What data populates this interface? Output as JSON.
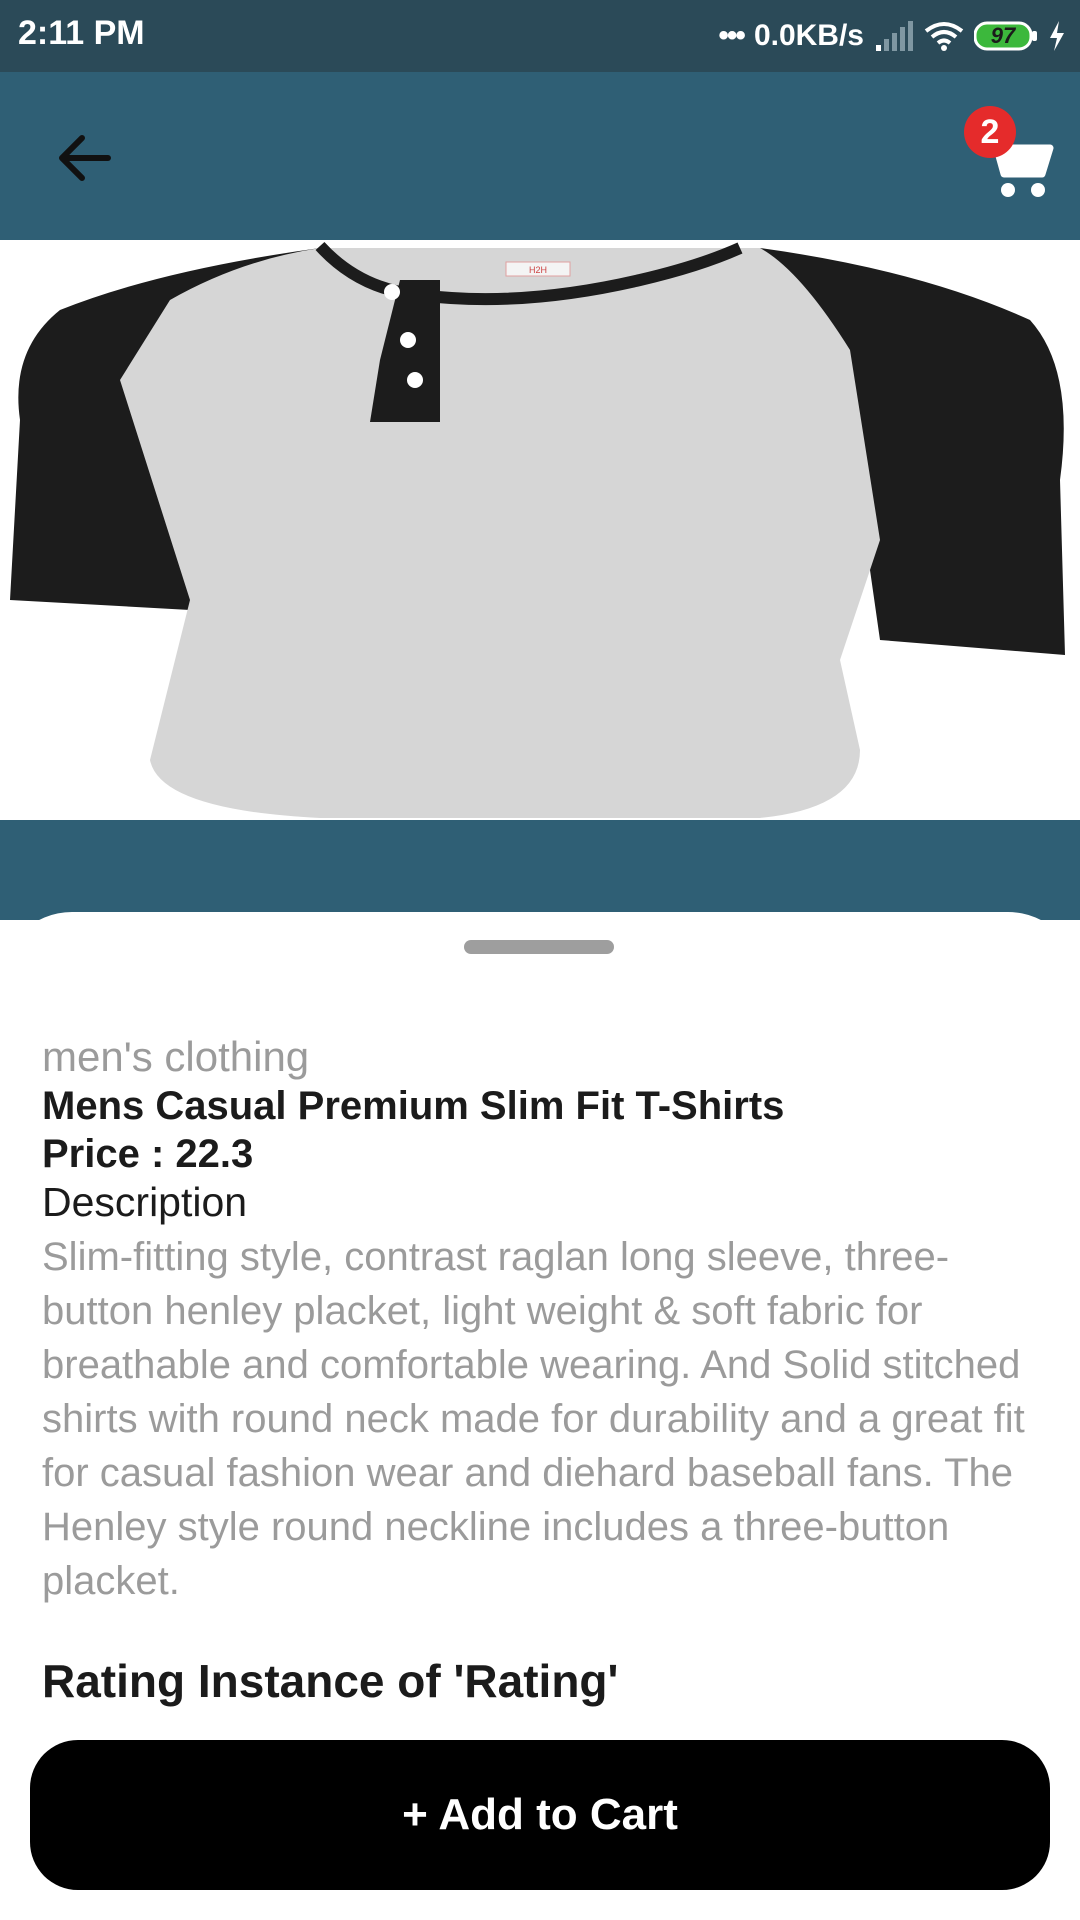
{
  "status_bar": {
    "time": "2:11 PM",
    "network_speed": "0.0KB/s",
    "battery": "97"
  },
  "app_bar": {
    "back_icon": "arrow-left-icon",
    "cart_icon": "shopping-cart-icon",
    "cart_count": "2"
  },
  "product": {
    "category": "men's clothing",
    "title": "Mens Casual Premium Slim Fit T-Shirts",
    "price_text": "Price : 22.3",
    "description_label": "Description",
    "description": "Slim-fitting style, contrast raglan long sleeve, three-button henley placket, light weight & soft fabric for breathable and comfortable wearing. And Solid stitched shirts with round neck made for durability and a great fit for casual fashion wear and diehard baseball fans. The Henley style round neckline includes a three-button placket.",
    "rating_heading": "Rating Instance of 'Rating'",
    "shirt_label_text": "H2H"
  },
  "actions": {
    "add_to_cart": "+ Add to Cart"
  },
  "colors": {
    "status_bar": "#2b4a58",
    "app_bar": "#2f5f75",
    "badge": "#e52b2b",
    "button": "#000000"
  }
}
